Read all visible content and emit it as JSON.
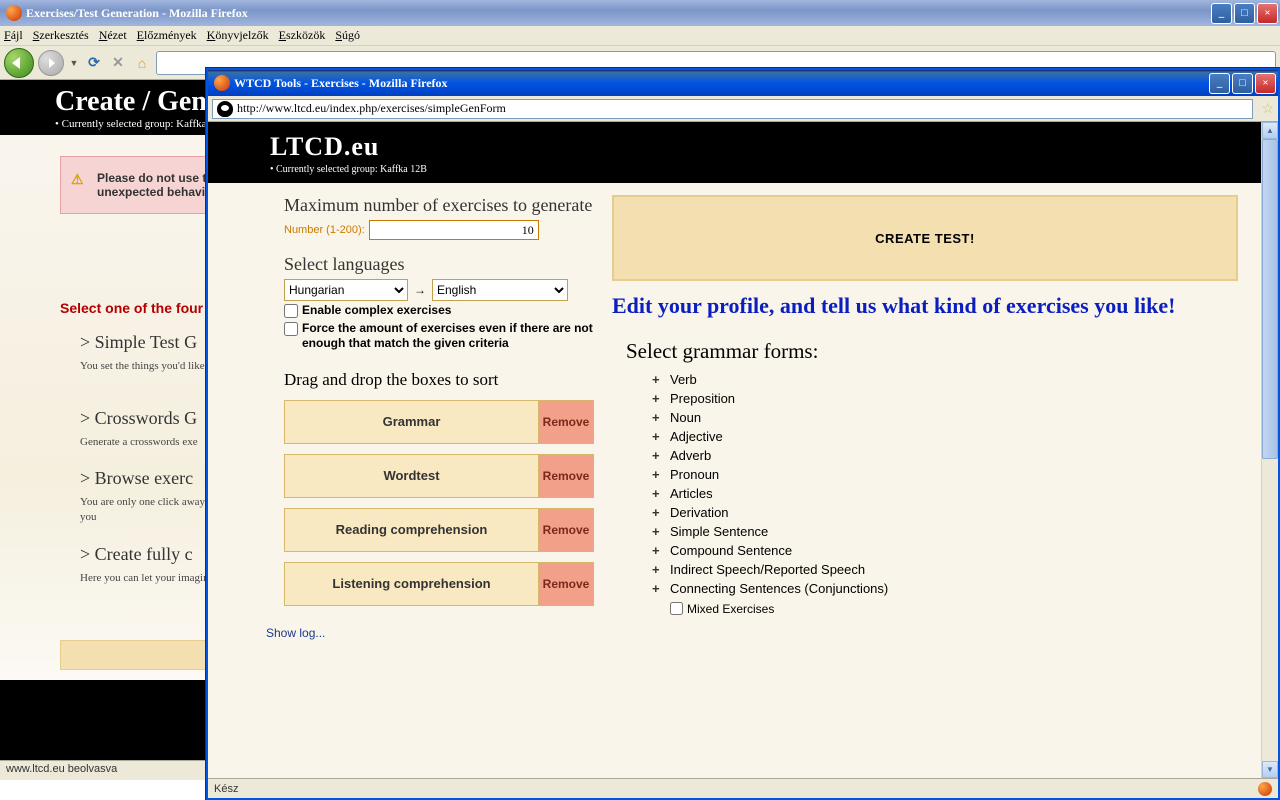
{
  "bgWindow": {
    "title": "Exercises/Test Generation - Mozilla Firefox",
    "menubar": [
      "Fájl",
      "Szerkesztés",
      "Nézet",
      "Előzmények",
      "Könyvjelzők",
      "Eszközök",
      "Súgó"
    ],
    "header_title": "Create / Gen",
    "selected_group": "Currently selected group: Kaffka",
    "warning": "Please do not use the browser's back/forward/refresh buttons during the generation process. This may result in unexpected behaviour and in ex",
    "select_heading": "Select one of the four",
    "opts": [
      {
        "title": "> Simple Test G",
        "desc": "You set the things you'd like to see on your test and we generate it for you. Very good for experimenting with test ge"
      },
      {
        "title": "> Crosswords G",
        "desc": "Generate a crosswords exe"
      },
      {
        "title": "> Browse exerc",
        "desc": "You are only one click away from browsing all our exercises. Select the exercises you want for the curriculum and level of you"
      },
      {
        "title": "> Create fully c",
        "desc": "Here you can let your imagination go wild and create unique exercises by yourself with our online editor! Try it now!"
      }
    ],
    "status": "www.ltcd.eu beolvasva"
  },
  "foreWindow": {
    "title": "WTCD Tools - Exercises - Mozilla Firefox",
    "url": "http://www.ltcd.eu/index.php/exercises/simpleGenForm",
    "site_title": "LTCD.eu",
    "selected_group": "Currently selected group: Kaffka 12B",
    "max_label": "Maximum number of exercises to generate",
    "num_label": "Number (1-200):",
    "num_value": "10",
    "lang_label": "Select languages",
    "lang_from": "Hungarian",
    "lang_to": "English",
    "cb_complex": "Enable complex exercises",
    "cb_force": "Force the amount of exercises even if there are not enough that match the given criteria",
    "drag_label": "Drag and drop the boxes to sort",
    "boxes": [
      "Grammar",
      "Wordtest",
      "Reading comprehension",
      "Listening comprehension"
    ],
    "remove_label": "Remove",
    "show_log": "Show log...",
    "create_test": "CREATE TEST!",
    "edit_profile": "Edit your profile, and tell us what kind of exercises you like!",
    "grammar_title": "Select grammar forms:",
    "grammar_items": [
      "Verb",
      "Preposition",
      "Noun",
      "Adjective",
      "Adverb",
      "Pronoun",
      "Articles",
      "Derivation",
      "Simple Sentence",
      "Compound Sentence",
      "Indirect Speech/Reported Speech",
      "Connecting Sentences (Conjunctions)"
    ],
    "mixed_label": "Mixed Exercises",
    "status": "Kész"
  }
}
